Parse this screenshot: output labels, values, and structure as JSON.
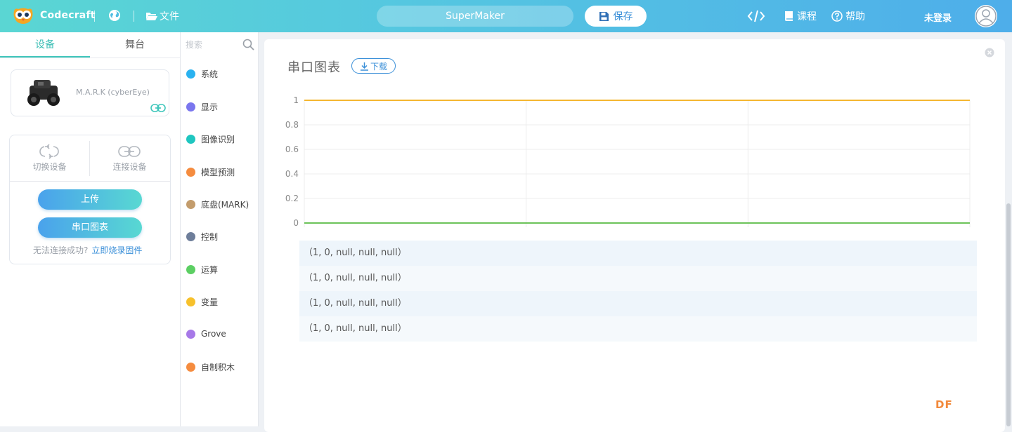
{
  "topbar": {
    "brand": "Codecraft",
    "file_label": "文件",
    "project_name": "SuperMaker",
    "save_label": "保存",
    "course_label": "课程",
    "help_label": "帮助",
    "login_label": "未登录"
  },
  "left": {
    "tabs": [
      {
        "label": "设备"
      },
      {
        "label": "舞台"
      }
    ],
    "device_name": "M.A.R.K (cyberEye)",
    "switch_label": "切换设备",
    "connect_label": "连接设备",
    "upload_label": "上传",
    "serial_chart_label": "串口图表",
    "fail_text": "无法连接成功?",
    "flash_link": "立即烧录固件"
  },
  "categories": {
    "search_placeholder": "搜索",
    "items": [
      {
        "label": "系统",
        "color": "#2ab2f0"
      },
      {
        "label": "显示",
        "color": "#7a76ee"
      },
      {
        "label": "图像识别",
        "color": "#1fc6c0"
      },
      {
        "label": "模型预测",
        "color": "#f58c3f"
      },
      {
        "label": "底盘(MARK)",
        "color": "#c39c6c"
      },
      {
        "label": "控制",
        "color": "#6e7e9a"
      },
      {
        "label": "运算",
        "color": "#5ccf63"
      },
      {
        "label": "变量",
        "color": "#f7c12c"
      },
      {
        "label": "Grove",
        "color": "#a779e8"
      },
      {
        "label": "自制积木",
        "color": "#f58c3f"
      }
    ]
  },
  "chart": {
    "title": "串口图表",
    "download_label": "下载"
  },
  "chart_data": {
    "type": "line",
    "title": "",
    "xlabel": "",
    "ylabel": "",
    "x": [
      0,
      1,
      2,
      3
    ],
    "ylim": [
      0,
      1
    ],
    "yticks": [
      "1",
      "0.8",
      "0.6",
      "0.4",
      "0.2",
      "0"
    ],
    "series": [
      {
        "values": [
          1,
          1,
          1,
          1
        ],
        "color": "#f5b731"
      },
      {
        "values": [
          0,
          0,
          0,
          0
        ],
        "color": "#6cc35a"
      }
    ]
  },
  "data_rows": [
    "（1, 0, null, null, null）",
    "（1, 0, null, null, null）",
    "（1, 0, null, null, null）",
    "（1, 0, null, null, null）"
  ],
  "watermark": "DF"
}
